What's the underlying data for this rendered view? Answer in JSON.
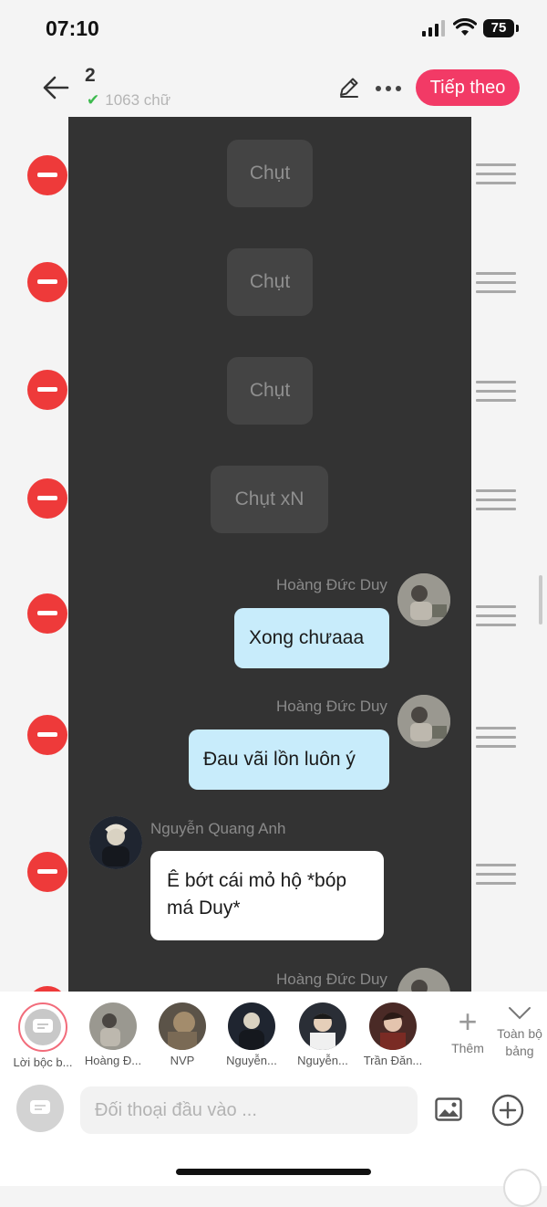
{
  "status": {
    "time": "07:10",
    "battery": "75"
  },
  "header": {
    "title": "2",
    "word_count": "1063 chữ",
    "next_label": "Tiếp theo"
  },
  "messages": [
    {
      "type": "system",
      "text": "Chụt"
    },
    {
      "type": "system",
      "text": "Chụt"
    },
    {
      "type": "system",
      "text": "Chụt"
    },
    {
      "type": "system",
      "text": "Chụt xN"
    },
    {
      "type": "me",
      "name": "Hoàng Đức Duy",
      "text": "Xong chưaaa"
    },
    {
      "type": "me",
      "name": "Hoàng Đức Duy",
      "text": "Đau vãi lồn luôn ý"
    },
    {
      "type": "other",
      "name": "Nguyễn Quang Anh",
      "text": "Ê bớt cái mỏ hộ *bóp má Duy*"
    },
    {
      "type": "me",
      "name": "Hoàng Đức Duy",
      "text": ""
    }
  ],
  "characters": [
    {
      "label": "Lời bộc b...",
      "selected": true
    },
    {
      "label": "Hoàng Đ..."
    },
    {
      "label": "NVP"
    },
    {
      "label": "Nguyễn..."
    },
    {
      "label": "Nguyễn..."
    },
    {
      "label": "Trần Đăn..."
    }
  ],
  "char_actions": {
    "add_label": "Thêm",
    "all_label": "Toàn bộ bảng"
  },
  "input": {
    "placeholder": "Đối thoại đầu vào ..."
  },
  "colors": {
    "accent": "#f23a66",
    "delete": "#ee3a3a",
    "my_bubble": "#c8ecfb",
    "canvas": "#333333"
  }
}
